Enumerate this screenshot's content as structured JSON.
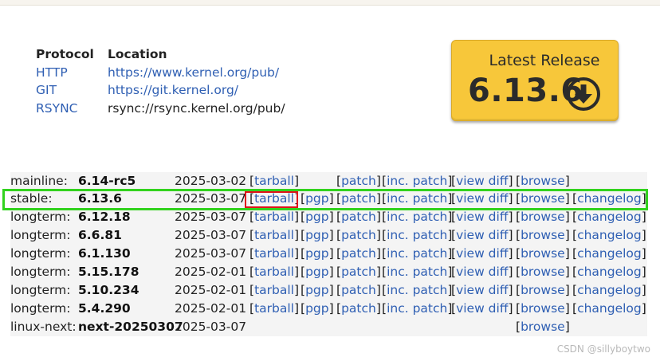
{
  "protocol": {
    "headers": {
      "protocol": "Protocol",
      "location": "Location"
    },
    "rows": [
      {
        "protocol": "HTTP",
        "location": "https://www.kernel.org/pub/"
      },
      {
        "protocol": "GIT",
        "location": "https://git.kernel.org/"
      },
      {
        "protocol": "RSYNC",
        "location": "rsync://rsync.kernel.org/pub/"
      }
    ]
  },
  "latest_release": {
    "label": "Latest Release",
    "version": "6.13.6",
    "icon": "download-circle-icon"
  },
  "releases": [
    {
      "kind": "mainline:",
      "version": "6.14-rc5",
      "date": "2025-03-02",
      "tarball": "tarball",
      "pgp": "",
      "patch": "patch",
      "inc_patch": "inc. patch",
      "view_diff": "view diff",
      "browse": "browse",
      "changelog": ""
    },
    {
      "kind": "stable:",
      "version": "6.13.6",
      "date": "2025-03-07",
      "tarball": "tarball",
      "pgp": "pgp",
      "patch": "patch",
      "inc_patch": "inc. patch",
      "view_diff": "view diff",
      "browse": "browse",
      "changelog": "changelog"
    },
    {
      "kind": "longterm:",
      "version": "6.12.18",
      "date": "2025-03-07",
      "tarball": "tarball",
      "pgp": "pgp",
      "patch": "patch",
      "inc_patch": "inc. patch",
      "view_diff": "view diff",
      "browse": "browse",
      "changelog": "changelog"
    },
    {
      "kind": "longterm:",
      "version": "6.6.81",
      "date": "2025-03-07",
      "tarball": "tarball",
      "pgp": "pgp",
      "patch": "patch",
      "inc_patch": "inc. patch",
      "view_diff": "view diff",
      "browse": "browse",
      "changelog": "changelog"
    },
    {
      "kind": "longterm:",
      "version": "6.1.130",
      "date": "2025-03-07",
      "tarball": "tarball",
      "pgp": "pgp",
      "patch": "patch",
      "inc_patch": "inc. patch",
      "view_diff": "view diff",
      "browse": "browse",
      "changelog": "changelog"
    },
    {
      "kind": "longterm:",
      "version": "5.15.178",
      "date": "2025-02-01",
      "tarball": "tarball",
      "pgp": "pgp",
      "patch": "patch",
      "inc_patch": "inc. patch",
      "view_diff": "view diff",
      "browse": "browse",
      "changelog": "changelog"
    },
    {
      "kind": "longterm:",
      "version": "5.10.234",
      "date": "2025-02-01",
      "tarball": "tarball",
      "pgp": "pgp",
      "patch": "patch",
      "inc_patch": "inc. patch",
      "view_diff": "view diff",
      "browse": "browse",
      "changelog": "changelog"
    },
    {
      "kind": "longterm:",
      "version": "5.4.290",
      "date": "2025-02-01",
      "tarball": "tarball",
      "pgp": "pgp",
      "patch": "patch",
      "inc_patch": "inc. patch",
      "view_diff": "view diff",
      "browse": "browse",
      "changelog": "changelog"
    },
    {
      "kind": "linux-next:",
      "version": "next-20250307",
      "date": "2025-03-07",
      "tarball": "",
      "pgp": "",
      "patch": "",
      "inc_patch": "",
      "view_diff": "",
      "browse": "browse",
      "changelog": ""
    }
  ],
  "watermark": "CSDN @sillyboytwo",
  "colors": {
    "link": "#2f5fb3",
    "button": "#f7c73a",
    "highlight_green": "#32d21e",
    "highlight_red": "#e0131a"
  }
}
